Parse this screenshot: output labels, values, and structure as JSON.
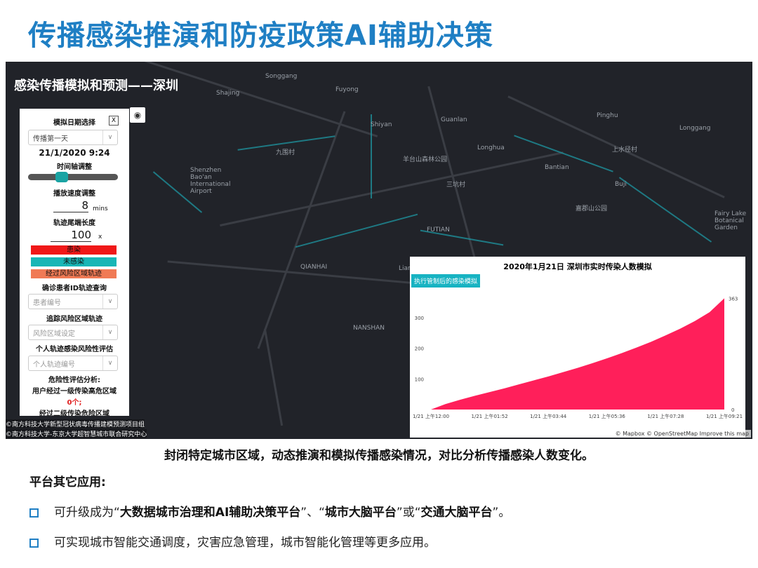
{
  "page": {
    "title": "传播感染推演和防疫政策AI辅助决策"
  },
  "map": {
    "title": "感染传播模拟和预测——深圳",
    "place_labels": [
      "Songgang",
      "Shajing",
      "Fuyong",
      "Shiyan",
      "Guanlan",
      "Longhua",
      "Pinghu",
      "Buji",
      "Longgang",
      "Bantian",
      "Shenzhen Bao'an International Airport",
      "QIANHAI",
      "NANSHAN",
      "FUTIAN",
      "Lianhua",
      "Fairy Lake Botanical Garden",
      "三坑村",
      "上水径村",
      "嘉郡山公园",
      "羊台山森林公园",
      "九围村"
    ],
    "attribution_line1": "©南方科技大学新型冠状病毒传播建模预测项目组",
    "attribution_line2": "©南方科技大学-东京大学超智慧城市联合研究中心",
    "mapbox_attribution": "© Mapbox © OpenStreetMap  Improve this map",
    "camera_icon": "camera-icon"
  },
  "panel": {
    "date_select_label": "模拟日期选择",
    "close_label": "X",
    "day_select_value": "传播第一天",
    "datetime": "21/1/2020 9:24",
    "timeline_label": "时间轴调整",
    "timeline_position": 0.35,
    "speed_label": "播放速度调整",
    "speed_value": "8",
    "speed_unit": "mins",
    "trail_label": "轨迹尾端长度",
    "trail_value": "100",
    "trail_unit": "x",
    "legend": [
      {
        "label": "患染",
        "color": "#f01818"
      },
      {
        "label": "未感染",
        "color": "#19b6b6"
      },
      {
        "label": "经过风险区域轨迹",
        "color": "#f07a55"
      }
    ],
    "patient_query_label": "确诊患者ID轨迹查询",
    "patient_placeholder": "患者编号",
    "risk_track_label": "追踪风险区域轨迹",
    "risk_placeholder": "风险区域设定",
    "personal_eval_label": "个人轨迹感染风险性评估",
    "personal_placeholder": "个人轨迹编号",
    "risk_analysis_label": "危险性评估分析:",
    "high_zone_label": "用户经过一级传染高危区域",
    "high_zone_count": "0个;",
    "second_zone_label": "经过二级传染危险区域"
  },
  "chart_panel": {
    "title": "2020年1月21日 深圳市实时传染人数模拟",
    "button_label": "执行管制后的感染模拟"
  },
  "chart_data": {
    "type": "area",
    "color": "#ff1f5a",
    "x_tick_labels": [
      "1/21 上午12:00",
      "1/21 上午01:52",
      "1/21 上午03:44",
      "1/21 上午05:36",
      "1/21 上午07:28",
      "1/21 上午09:21"
    ],
    "y_tick_labels": [
      "0",
      "100",
      "200",
      "300"
    ],
    "ylim": [
      0,
      380
    ],
    "max_label": "363",
    "x": [
      0,
      1,
      2,
      3,
      4,
      5,
      6,
      7,
      8,
      9,
      10,
      11,
      12,
      13,
      14,
      15,
      16,
      17,
      18,
      19,
      20
    ],
    "values": [
      0,
      18,
      32,
      45,
      57,
      69,
      82,
      95,
      108,
      122,
      136,
      151,
      167,
      184,
      202,
      221,
      242,
      264,
      289,
      318,
      363
    ]
  },
  "caption": "封闭特定城市区域，动态推演和模拟传播感染情况，对比分析传播感染人数变化。",
  "other_apps_title": "平台其它应用:",
  "bullets": {
    "b1_pre": "可升级成为“",
    "b1_bold1": "大数据城市治理和AI辅助决策平台",
    "b1_mid": "”、“",
    "b1_bold2": "城市大脑平台",
    "b1_or": "”或“",
    "b1_bold3": "交通大脑平台",
    "b1_end": "”。",
    "b2": "可实现城市智能交通调度，灾害应急管理，城市智能化管理等更多应用。"
  }
}
